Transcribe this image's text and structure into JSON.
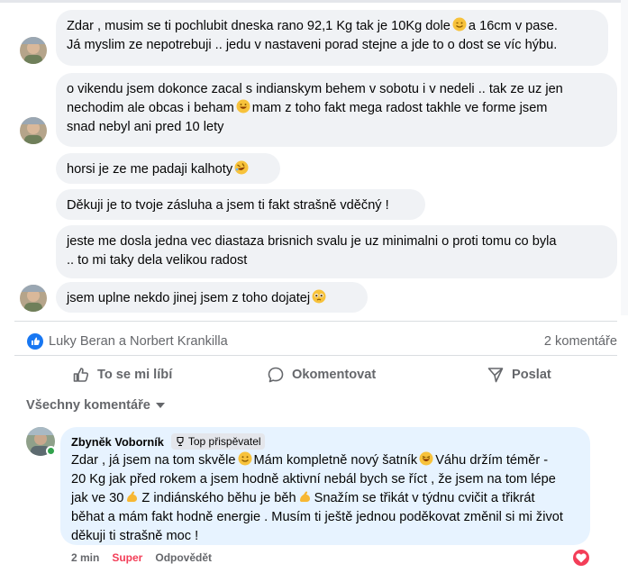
{
  "messages": [
    {
      "text_a": "Zdar , musim se ti pochlubit dneska rano 92,1 Kg tak je 10Kg dole",
      "text_b": "a 16cm v pase.",
      "text_c": "Já myslim ze nepotrebuji .. jedu v nastaveni porad stejne a jde to o dost se víc hýbu."
    },
    {
      "text_a": "o vikendu jsem dokonce zacal s indianskym behem v sobotu i v nedeli .. tak ze uz jen",
      "text_b": "nechodim ale obcas i beham",
      "text_c": "mam z toho fakt mega radost takhle ve forme jsem",
      "text_d": "snad nebyl ani pred 10 lety"
    },
    {
      "text_a": "horsi je ze me padaji kalhoty"
    },
    {
      "text_a": "Děkuji je to tvoje zásluha a jsem ti fakt strašně vděčný !"
    },
    {
      "text_a": "jeste me dosla jedna vec diastaza brisnich svalu je uz minimalni o proti tomu co byla",
      "text_b": ".. to mi taky dela velikou radost"
    },
    {
      "text_a": "jsem uplne nekdo jinej jsem z toho dojatej"
    }
  ],
  "reactions": {
    "names": "Luky Beran a Norbert Krankilla",
    "comment_count": "2 komentáře"
  },
  "actions": {
    "like": "To se mi líbí",
    "comment": "Okomentovat",
    "share": "Poslat"
  },
  "sort_label": "Všechny komentáře",
  "comment": {
    "author": "Zbyněk Voborník",
    "badge": "Top přispěvatel",
    "line1_a": "Zdar , já jsem na tom skvěle",
    "line1_b": "Mám kompletně nový šatník",
    "line1_c": "Váhu držím téměr -",
    "line2": "20 Kg jak před rokem a jsem hodně aktivní nebál bych se říct , že jsem na tom lépe",
    "line3_a": "jak ve 30",
    "line3_b": "Z indiánského běhu je běh",
    "line3_c": "Snažím se třikát v týdnu cvičit a třikrát",
    "line4": "běhat a mám fakt hodně energie . Musím ti ještě jednou poděkovat změnil si mi život",
    "line5": "děkuji ti strašně moc !",
    "time": "2 min",
    "reaction_label": "Super",
    "reply_label": "Odpovědět"
  },
  "colors": {
    "accent": "#1877f2",
    "bubble": "#f0f2f5",
    "comment_bubble": "#e7f3ff",
    "heart": "#f33e58",
    "online": "#31a24c"
  }
}
